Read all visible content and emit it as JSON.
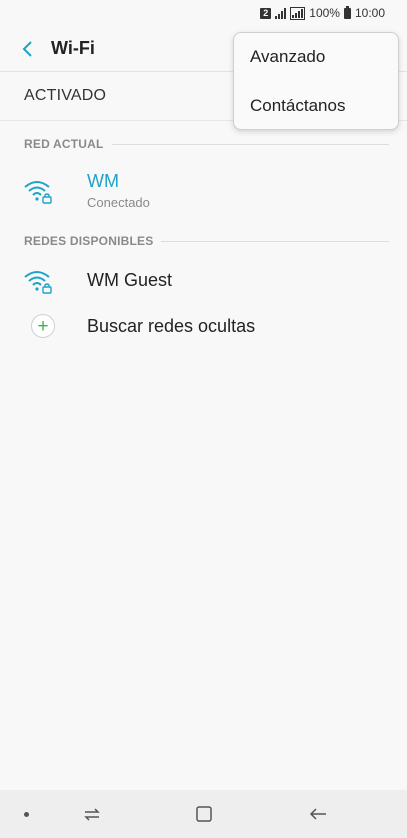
{
  "status_bar": {
    "sim_slot": "2",
    "battery": "100%",
    "time": "10:00"
  },
  "header": {
    "title": "Wi-Fi",
    "back_icon": "chevron-left-icon"
  },
  "toggle_row": {
    "label": "ACTIVADO"
  },
  "current_network_section": {
    "title": "RED ACTUAL",
    "network": {
      "name": "WM",
      "status": "Conectado",
      "icon": "wifi-locked-icon"
    }
  },
  "available_section": {
    "title": "REDES DISPONIBLES",
    "networks": [
      {
        "name": "WM Guest",
        "icon": "wifi-locked-icon"
      }
    ],
    "search_hidden": {
      "label": "Buscar redes ocultas",
      "icon": "plus-icon"
    }
  },
  "popup_menu": {
    "items": [
      {
        "label": "Avanzado"
      },
      {
        "label": "Contáctanos"
      }
    ]
  },
  "colors": {
    "accent": "#1da3c8",
    "plus_green": "#3cb44b",
    "background": "#f8f8f8"
  },
  "nav_bar": {
    "icons": [
      "dot-icon",
      "recent-apps-icon",
      "home-icon",
      "back-arrow-icon"
    ]
  }
}
